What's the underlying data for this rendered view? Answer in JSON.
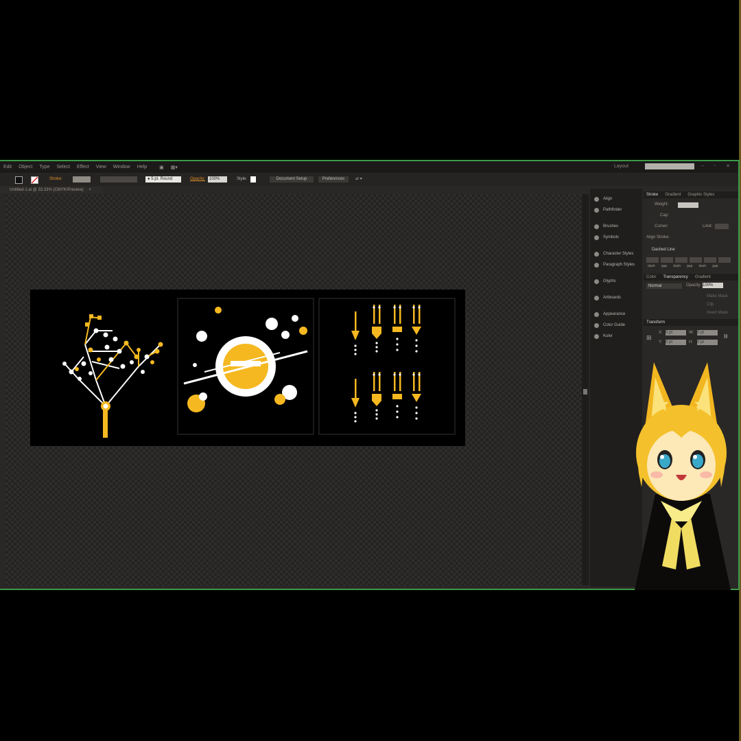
{
  "menu": [
    "Edit",
    "Object",
    "Type",
    "Select",
    "Effect",
    "View",
    "Window",
    "Help"
  ],
  "workspace_label": "Layout",
  "control_bar": {
    "stroke_label": "Stroke:",
    "brush_label": "5 pt. Round",
    "opacity_label": "Opacity:",
    "opacity_value": "100%",
    "style_label": "Style:",
    "document_setup": "Document Setup",
    "preferences": "Preferences"
  },
  "document_tab": "Untitled-1.ai @ 33.33% (CMYK/Preview)",
  "icon_panels": [
    {
      "label": "Align",
      "icon": "align-icon"
    },
    {
      "label": "Pathfinder",
      "icon": "pathfinder-icon"
    },
    {
      "label": "Brushes",
      "icon": "brushes-icon"
    },
    {
      "label": "Symbols",
      "icon": "symbols-icon"
    },
    {
      "label": "Character Styles",
      "icon": "character-styles-icon"
    },
    {
      "label": "Paragraph Styles",
      "icon": "paragraph-styles-icon"
    },
    {
      "label": "Glyphs",
      "icon": "glyphs-icon"
    },
    {
      "label": "Artboards",
      "icon": "artboards-icon"
    },
    {
      "label": "Appearance",
      "icon": "appearance-icon"
    },
    {
      "label": "Color Guide",
      "icon": "color-guide-icon"
    },
    {
      "label": "Kuler",
      "icon": "kuler-icon"
    }
  ],
  "stroke_panel": {
    "tabs": [
      "Stroke",
      "Gradient",
      "Graphic Styles"
    ],
    "weight_label": "Weight:",
    "cap_label": "Cap:",
    "corner_label": "Corner:",
    "limit_label": "Limit:",
    "align_label": "Align Stroke:",
    "dashed_label": "Dashed Line",
    "dash_labels": [
      "dash",
      "gap",
      "dash",
      "gap",
      "dash",
      "gap"
    ]
  },
  "transparency_panel": {
    "tabs": [
      "Color",
      "Transparency",
      "Gradient"
    ],
    "blend_mode": "Normal",
    "opacity_label": "Opacity:",
    "opacity_value": "100%",
    "make_mask": "Make Mask",
    "clip": "Clip",
    "invert_mask": "Invert Mask"
  },
  "transform_panel": {
    "title": "Transform",
    "x_label": "X:",
    "y_label": "Y:",
    "w_label": "W:",
    "h_label": "H:",
    "x_value": "0 pt",
    "y_value": "0 pt",
    "w_value": "0 pt",
    "h_value": "0 pt"
  },
  "colors": {
    "accent": "#f5b820",
    "white": "#ffffff",
    "frame": "#3c9a4a"
  }
}
